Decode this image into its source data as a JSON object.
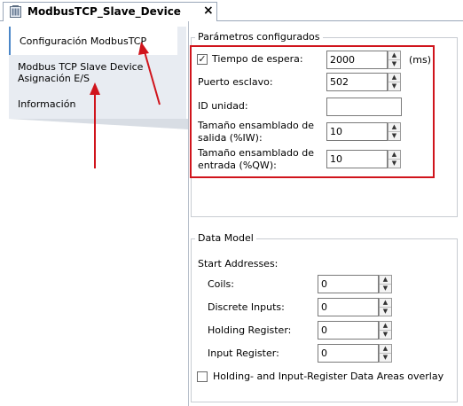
{
  "document_tab": {
    "title": "ModbusTCP_Slave_Device",
    "icon": "device-icon",
    "close_label": "×"
  },
  "nav": {
    "items": [
      {
        "label": "Configuración ModbusTCP"
      },
      {
        "label_line1": "Modbus TCP Slave Device",
        "label_line2": "Asignación E/S"
      },
      {
        "label": "Información"
      }
    ]
  },
  "params": {
    "group_title": "Parámetros configurados",
    "timeout": {
      "label": "Tiempo de espera:",
      "checked": true,
      "value": "2000",
      "unit": "(ms)"
    },
    "slave_port": {
      "label": "Puerto esclavo:",
      "value": "502"
    },
    "unit_id": {
      "label": "ID unidad:",
      "value": ""
    },
    "output_size": {
      "label_line1": "Tamaño ensamblado de",
      "label_line2": "salida (%IW):",
      "value": "10"
    },
    "input_size": {
      "label_line1": "Tamaño ensamblado de",
      "label_line2": "entrada (%QW):",
      "value": "10"
    }
  },
  "data_model": {
    "group_title": "Data Model",
    "start_addresses_label": "Start Addresses:",
    "fields": [
      {
        "label": "Coils:",
        "value": "0"
      },
      {
        "label": "Discrete Inputs:",
        "value": "0"
      },
      {
        "label": "Holding Register:",
        "value": "0"
      },
      {
        "label": "Input Register:",
        "value": "0"
      }
    ],
    "overlay": {
      "label": "Holding- and Input-Register Data Areas overlay",
      "checked": false
    }
  },
  "annotations": {
    "highlight_color": "#d0141c"
  }
}
